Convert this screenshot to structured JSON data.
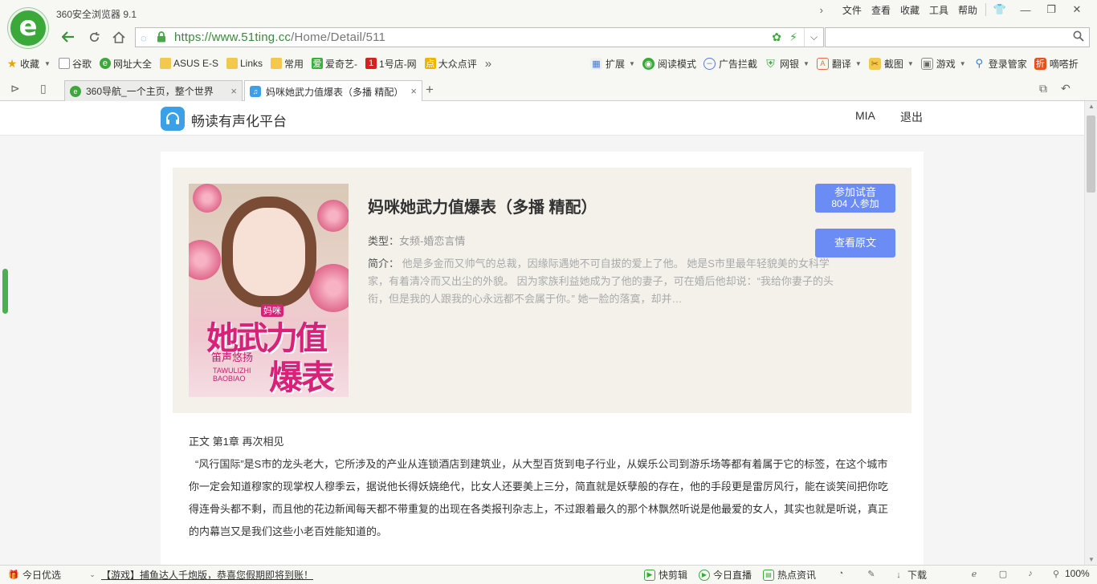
{
  "browser": {
    "app_title": "360安全浏览器 9.1",
    "logo_glyph": "e",
    "menu": [
      "文件",
      "查看",
      "收藏",
      "工具",
      "帮助"
    ],
    "window_buttons": {
      "skin": "👕",
      "minimize": "—",
      "restore": "❐",
      "close": "✕"
    },
    "address": {
      "scheme_host": "https://www.51ting.cc",
      "path": "/Home/Detail/511"
    },
    "search": {
      "placeholder": ""
    },
    "bookmarks": [
      {
        "label": "收藏",
        "icon": "star-icon"
      },
      {
        "label": "谷歌",
        "icon": "page-icon"
      },
      {
        "label": "网址大全",
        "icon": "360-icon"
      },
      {
        "label": "ASUS E-S",
        "icon": "folder-icon"
      },
      {
        "label": "Links",
        "icon": "folder-icon"
      },
      {
        "label": "常用",
        "icon": "folder-icon"
      },
      {
        "label": "爱奇艺-",
        "icon": "iqiyi-icon"
      },
      {
        "label": "1号店-网",
        "icon": "yhd-icon"
      },
      {
        "label": "大众点评",
        "icon": "dianping-icon"
      }
    ],
    "more_bookmarks": "»",
    "tools": [
      {
        "label": "扩展",
        "icon": "extension-icon",
        "caret": true
      },
      {
        "label": "阅读模式",
        "icon": "reader-icon",
        "caret": false
      },
      {
        "label": "广告拦截",
        "icon": "adblock-icon",
        "caret": false
      },
      {
        "label": "网银",
        "icon": "bank-icon",
        "caret": true
      },
      {
        "label": "翻译",
        "icon": "translate-icon",
        "caret": true
      },
      {
        "label": "截图",
        "icon": "screenshot-icon",
        "caret": true
      },
      {
        "label": "游戏",
        "icon": "game-icon",
        "caret": true
      },
      {
        "label": "登录管家",
        "icon": "login-icon",
        "caret": false
      },
      {
        "label": "嘀嗒折",
        "icon": "discount-icon",
        "caret": false
      }
    ],
    "tabs": [
      {
        "title": "360导航_一个主页，整个世界",
        "active": false
      },
      {
        "title": "妈咪她武力值爆表（多播 精配）",
        "active": true
      }
    ],
    "new_tab": "+"
  },
  "site": {
    "name": "畅读有声化平台",
    "user": "MIA",
    "logout": "退出"
  },
  "book": {
    "title": "妈咪她武力值爆表（多播 精配）",
    "genre_label": "类型：",
    "genre_value": "女频-婚恋言情",
    "synopsis_label": "简介：",
    "synopsis_text": "他是多金而又帅气的总裁，因缘际遇她不可自拔的爱上了他。 她是S市里最年轻貌美的女科学家，有着清冷而又出尘的外貌。 因为家族利益她成为了他的妻子，可在婚后他却说：“我给你妻子的头衔，但是我的人跟我的心永远都不会属于你。” 她一脸的落寞，却并…",
    "try_listen_label": "参加试音",
    "participants": "804 人参加",
    "view_original": "查看原文",
    "cover": {
      "badge": "妈咪",
      "title_line1": "她武力值",
      "title_line2": "爆表",
      "author": "笛声悠扬",
      "pinyin_line1": "TAWULIZHI",
      "pinyin_line2": "BAOBIAO"
    }
  },
  "chapter": {
    "title": "正文 第1章 再次相见",
    "body": "“风行国际”是S市的龙头老大，它所涉及的产业从连锁酒店到建筑业，从大型百货到电子行业，从娱乐公司到游乐场等都有着属于它的标签，在这个城市你一定会知道穆家的现掌权人穆季云，据说他长得妖娆绝代，比女人还要美上三分，简直就是妖孽般的存在，他的手段更是雷厉风行，能在谈笑间把你吃得连骨头都不剩，而且他的花边新闻每天都不带重复的出现在各类报刊杂志上，不过跟着最久的那个林飘然听说是他最爱的女人，其实也就是听说，真正的内幕岂又是我们这些小老百姓能知道的。"
  },
  "statusbar": {
    "left": "今日优选",
    "news": "【游戏】捕鱼达人千炮版，恭喜您假期即将到账！",
    "items": [
      "快剪辑",
      "今日直播",
      "热点资讯"
    ],
    "download": "下载",
    "zoom": "100%"
  },
  "colors": {
    "accent_green": "#3aa93a",
    "button_blue": "#6b8cf5",
    "panel_bg": "#f3f1ea"
  }
}
